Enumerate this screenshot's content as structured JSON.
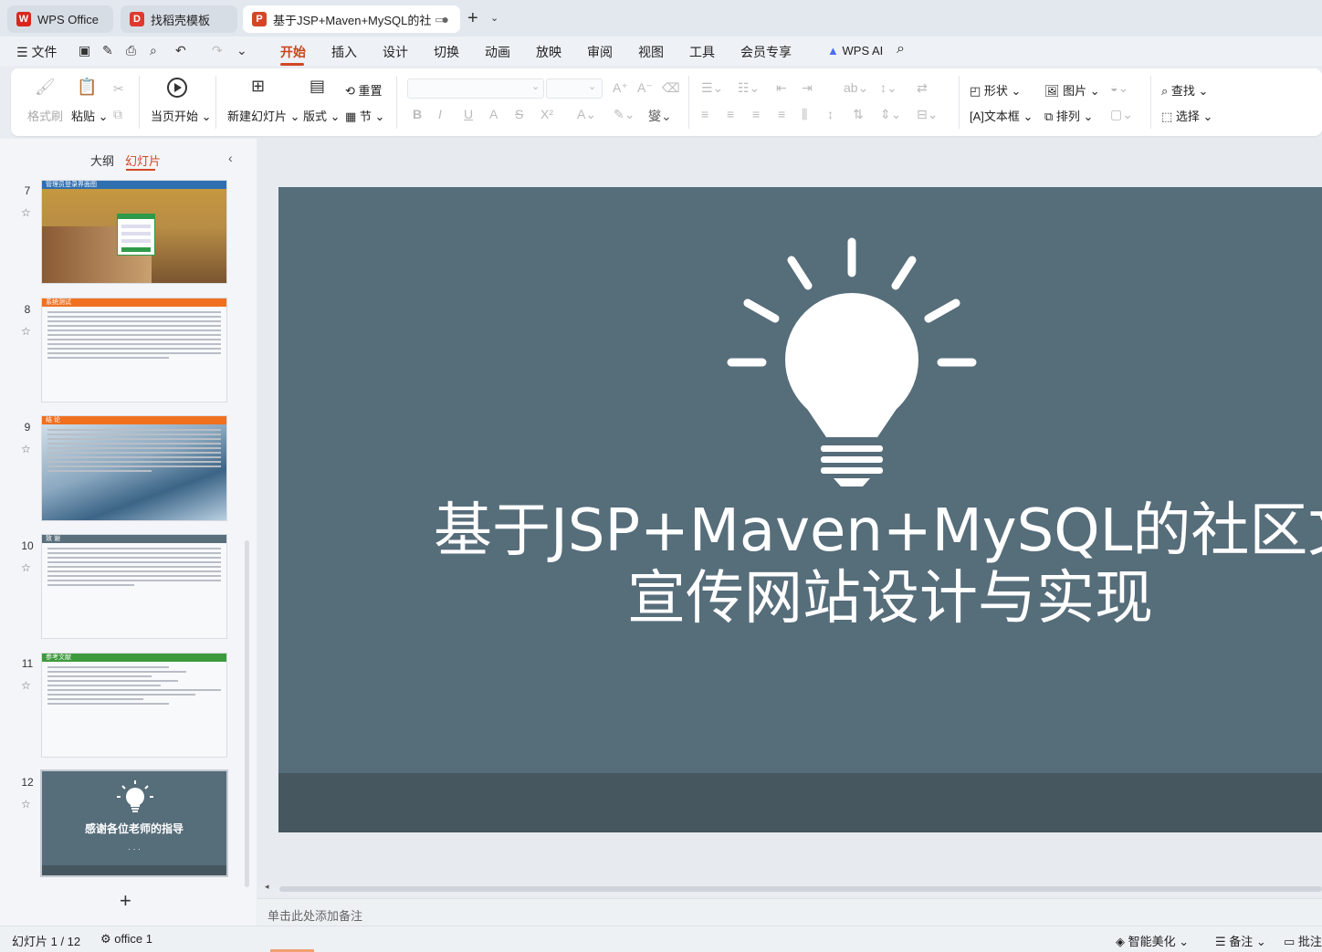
{
  "tabs": [
    {
      "label": "WPS Office",
      "logo": "W",
      "color": "#d9261c"
    },
    {
      "label": "找稻壳模板",
      "logo": "D",
      "color": "#e0382f"
    },
    {
      "label": "基于JSP+Maven+MySQL的社",
      "logo": "P",
      "color": "#d24726"
    }
  ],
  "menu": {
    "file": "文件",
    "items": [
      "开始",
      "插入",
      "设计",
      "切换",
      "动画",
      "放映",
      "审阅",
      "视图",
      "工具",
      "会员专享"
    ],
    "wps_ai": "WPS AI"
  },
  "ribbon": {
    "format_painter": "格式刷",
    "paste": "粘贴",
    "start_from_current": "当页开始",
    "new_slide": "新建幻灯片",
    "layout": "版式",
    "reset": "重置",
    "section": "节",
    "shape": "形状",
    "picture": "图片",
    "textbox": "文本框",
    "arrange": "排列",
    "find": "查找",
    "select": "选择"
  },
  "left_panel": {
    "outline_tab": "大纲",
    "slides_tab": "幻灯片",
    "slides": [
      {
        "num": "7",
        "title": "管理员登录界面图",
        "bar_color": "#2f6fb0"
      },
      {
        "num": "8",
        "title": "系统测试",
        "bar_color": "#f07020"
      },
      {
        "num": "9",
        "title": "结  论",
        "bar_color": "#f07020"
      },
      {
        "num": "10",
        "title": "致  谢",
        "bar_color": "#5a6f7c"
      },
      {
        "num": "11",
        "title": "参考文献",
        "bar_color": "#3c9a3c"
      },
      {
        "num": "12",
        "title": "感谢各位老师的指导",
        "sub": "· · ·"
      }
    ]
  },
  "slide": {
    "title_line1": "基于JSP+Maven+MySQL的社区文化",
    "title_line2": "宣传网站设计与实现",
    "bg_color": "#566d7a",
    "footer_color": "#47575f"
  },
  "notes_placeholder": "单击此处添加备注",
  "status": {
    "slide_counter": "幻灯片 1 / 12",
    "theme": "office 1",
    "smart_beautify": "智能美化",
    "notes": "备注",
    "comments": "批注"
  }
}
